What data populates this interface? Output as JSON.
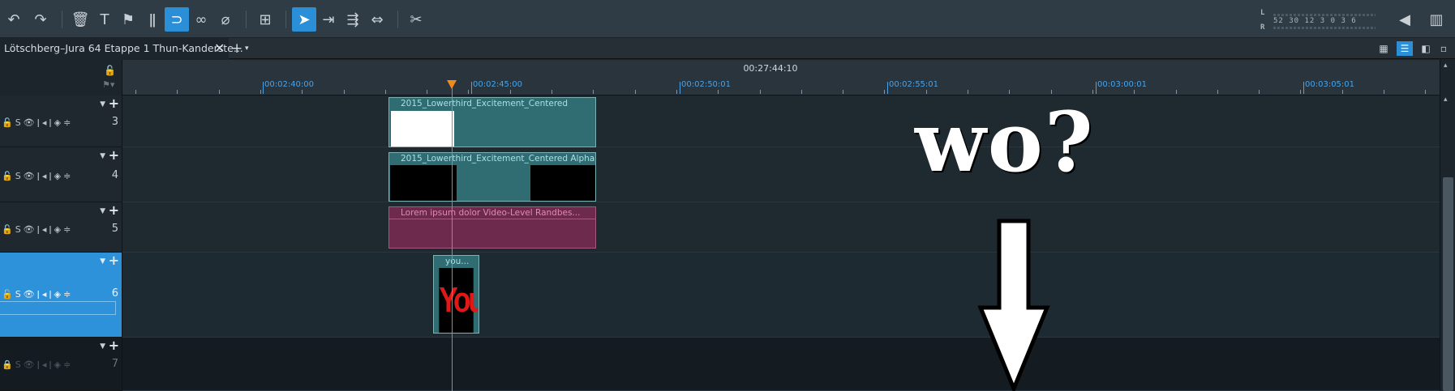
{
  "toolbar": {
    "buttons": [
      {
        "name": "undo-button",
        "glyph": "↶"
      },
      {
        "name": "redo-button",
        "glyph": "↷"
      },
      {
        "name": "delete-button",
        "glyph": "🗑"
      },
      {
        "name": "title-button",
        "glyph": "T"
      },
      {
        "name": "marker-button",
        "glyph": "⚑"
      },
      {
        "name": "split-button",
        "glyph": "ǁ"
      },
      {
        "name": "snap-button",
        "glyph": "⊃"
      },
      {
        "name": "link-button",
        "glyph": "∞"
      },
      {
        "name": "unlink-button",
        "glyph": "⌀"
      },
      {
        "name": "insert-button",
        "glyph": "⊞"
      },
      {
        "name": "mouse-mode-button",
        "glyph": "➤"
      },
      {
        "name": "range-mode-button",
        "glyph": "⇥"
      },
      {
        "name": "multi-mode-button",
        "glyph": "⇶"
      },
      {
        "name": "stretch-mode-button",
        "glyph": "⇔"
      },
      {
        "name": "cut-mode-button",
        "glyph": "✂"
      }
    ],
    "meter": {
      "left_label": "L",
      "right_label": "R",
      "scale": "52  30  12     3  0  3  6"
    }
  },
  "tabs": {
    "project_title": "Lötschberg–Jura 64 Etappe 1 Thun-Kanderste...",
    "close_glyph": "✕",
    "add_glyph": "+",
    "dropdown_glyph": "▾"
  },
  "timeline": {
    "position_timecode": "00:27:44:10",
    "tick_labels": [
      "00:02:40:00",
      "00:02:45:00",
      "00:02:50:01",
      "00:02:55:01",
      "00:03:00:01",
      "00:03:05:01"
    ]
  },
  "tracks": [
    {
      "number": "3",
      "icons": "🔓S👁ǀ◂ǀ◈≑"
    },
    {
      "number": "4",
      "icons": "🔓S👁ǀ◂ǀ◈≑"
    },
    {
      "number": "5",
      "icons": "🔓S👁ǀ◂ǀ◈≑"
    },
    {
      "number": "6",
      "icons": "🔓S👁ǀ◂ǀ◈≑"
    },
    {
      "number": "7",
      "icons": "🔒S👁ǀ◂ǀ◈≑"
    }
  ],
  "clips": {
    "c1": "2015_Lowerthird_Excitement_Centered",
    "c2": "2015_Lowerthird_Excitement_Centered Alpha",
    "c3": "Lorem ipsum dolor   Video-Level  Randbes...",
    "c4": "you...",
    "c4_thumb": "You"
  },
  "annotation": {
    "text": "wo?"
  },
  "colors": {
    "accent": "#2e92db",
    "playhead": "#f08a1c",
    "clip_teal": "#2f6d73",
    "clip_pink": "#6e2a4c"
  }
}
